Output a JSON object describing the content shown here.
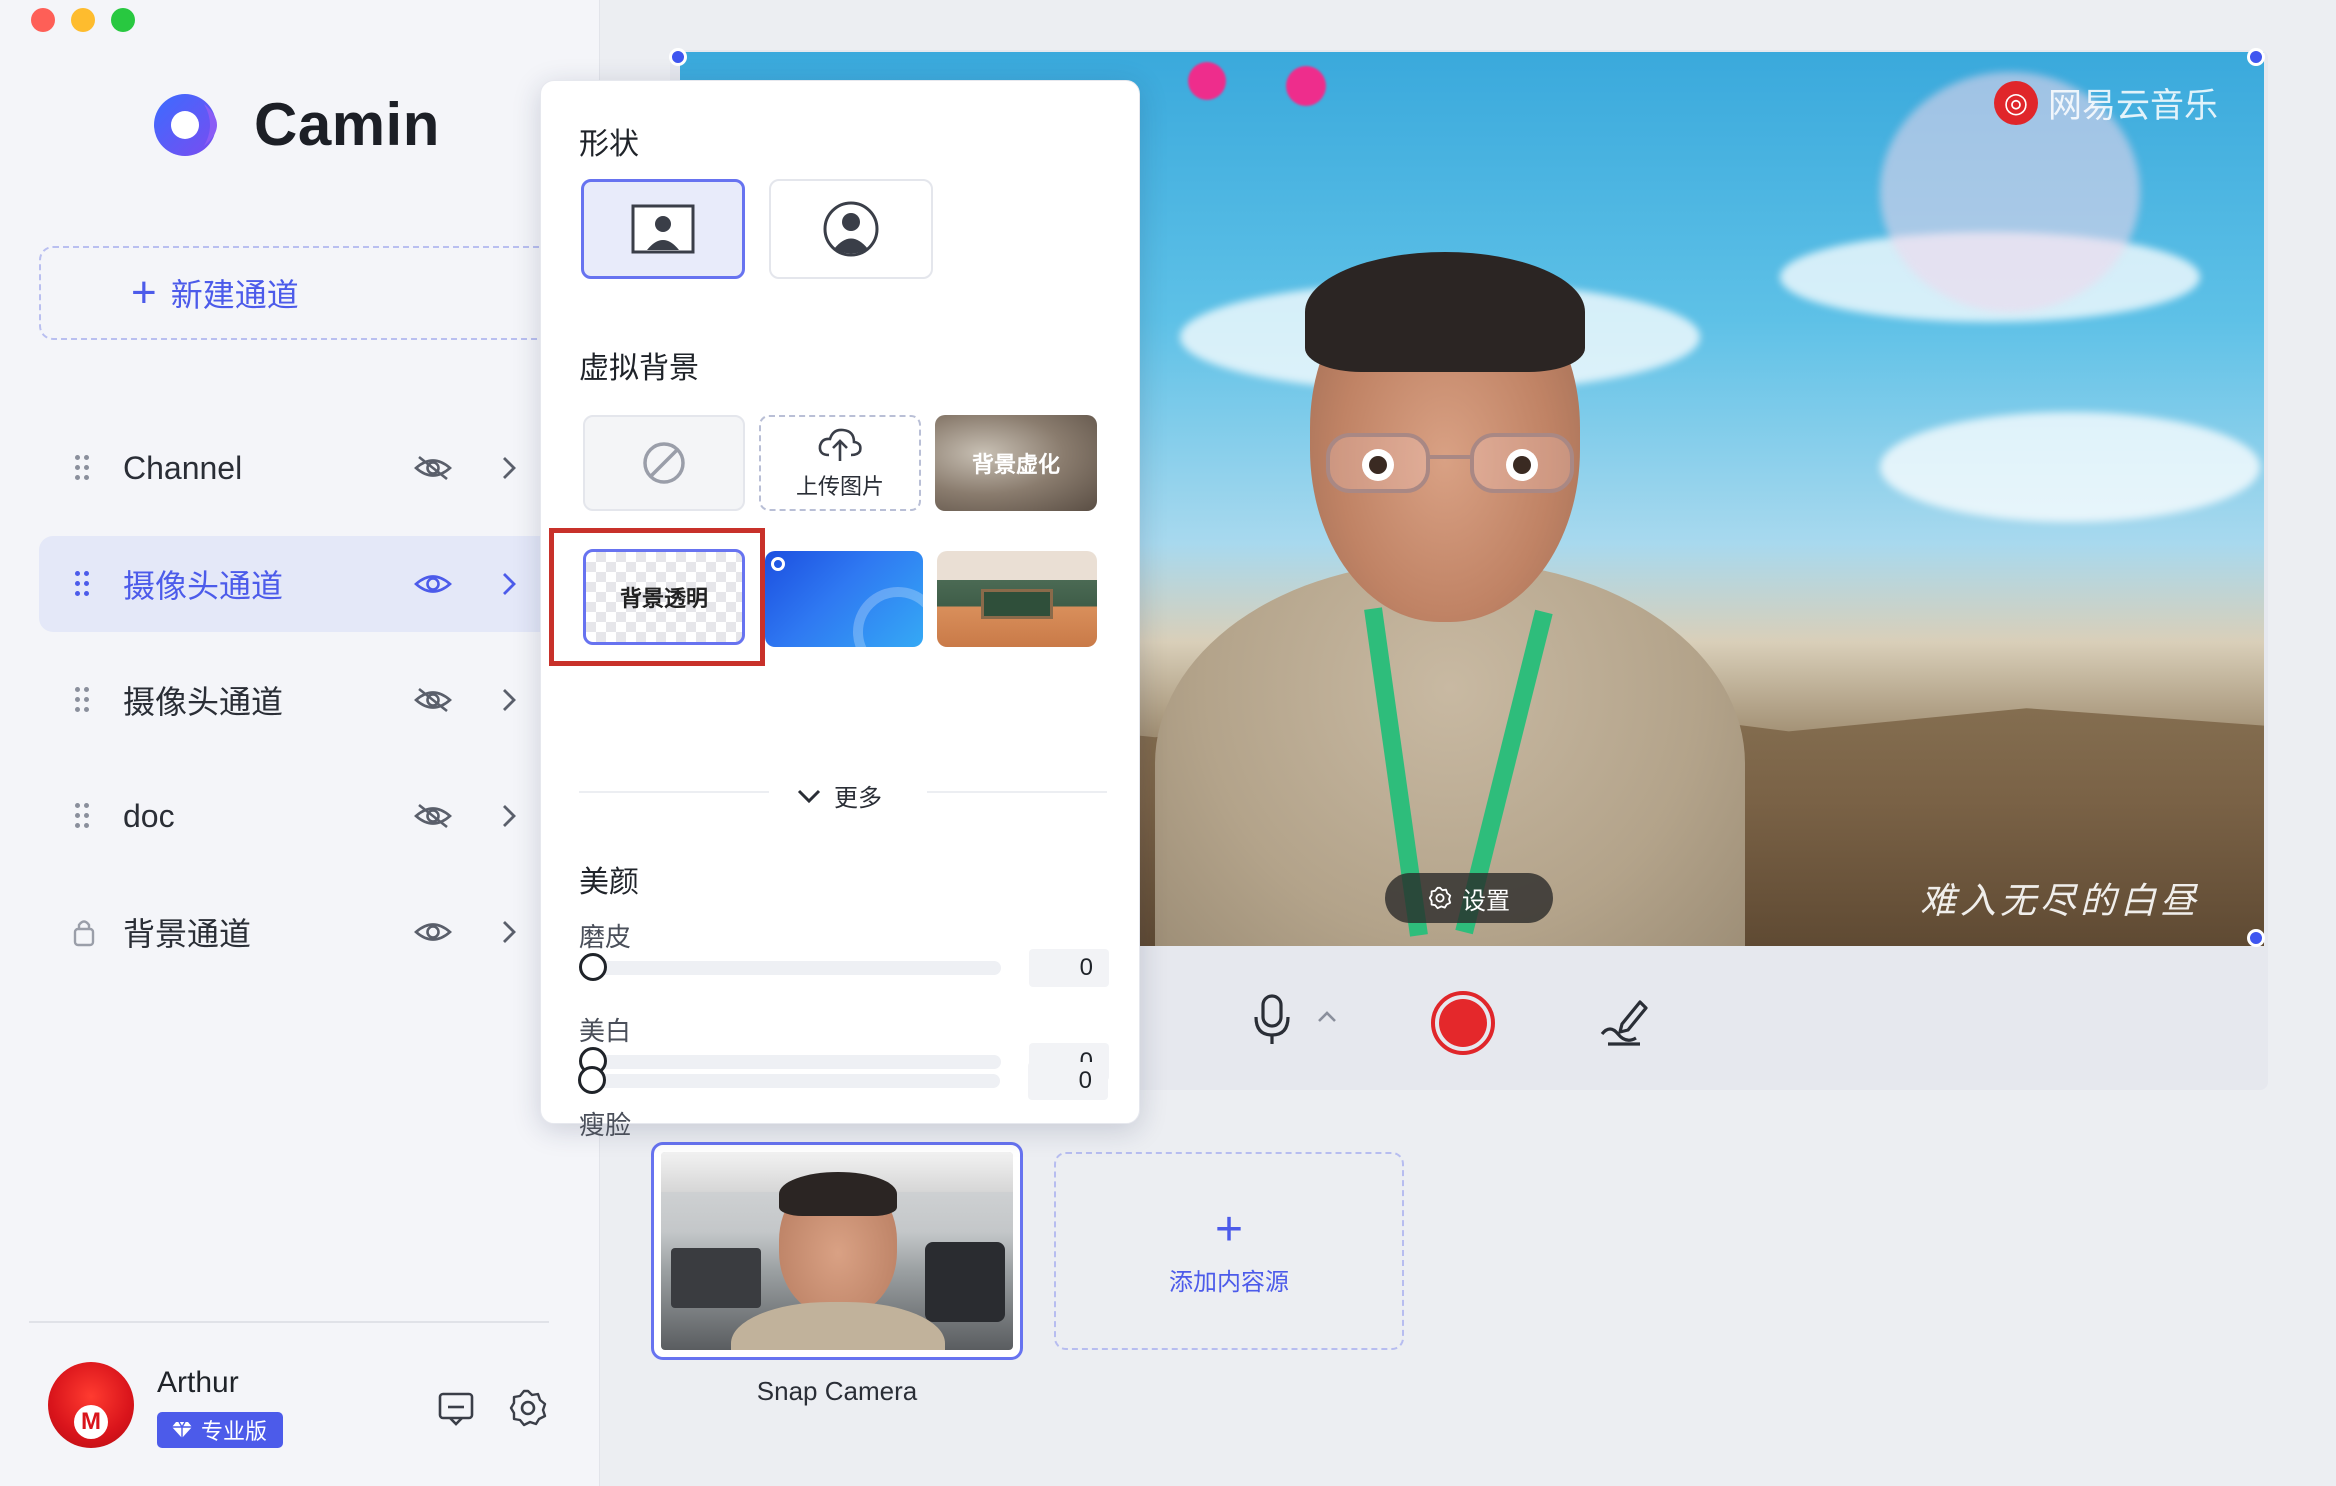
{
  "app": {
    "name": "Camin"
  },
  "sidebar": {
    "new_channel_label": "新建通道",
    "channels": [
      {
        "label": "Channel",
        "visible": false,
        "locked": false,
        "active": false
      },
      {
        "label": "摄像头通道",
        "visible": true,
        "locked": false,
        "active": true
      },
      {
        "label": "摄像头通道",
        "visible": false,
        "locked": false,
        "active": false
      },
      {
        "label": "doc",
        "visible": false,
        "locked": false,
        "active": false
      },
      {
        "label": "背景通道",
        "visible": true,
        "locked": true,
        "active": false
      }
    ]
  },
  "user": {
    "name": "Arthur",
    "badge": "专业版"
  },
  "preview": {
    "watermark": "网易云音乐",
    "lyric": "难入无尽的白昼",
    "settings_label": "设置"
  },
  "sources": {
    "items": [
      {
        "label": "Snap Camera"
      }
    ],
    "add_label": "添加内容源"
  },
  "popover": {
    "shape_title": "形状",
    "vbg_title": "虚拟背景",
    "upload_label": "上传图片",
    "blur_label": "背景虚化",
    "transparent_label": "背景透明",
    "more_label": "更多",
    "beauty_title": "美颜",
    "sliders": [
      {
        "label": "磨皮",
        "value": "0"
      },
      {
        "label": "美白",
        "value": "0"
      },
      {
        "label": "瘦脸",
        "value": "0"
      }
    ]
  },
  "colors": {
    "accent": "#4c5bea",
    "record": "#e4282b",
    "highlight": "#c8312a"
  }
}
